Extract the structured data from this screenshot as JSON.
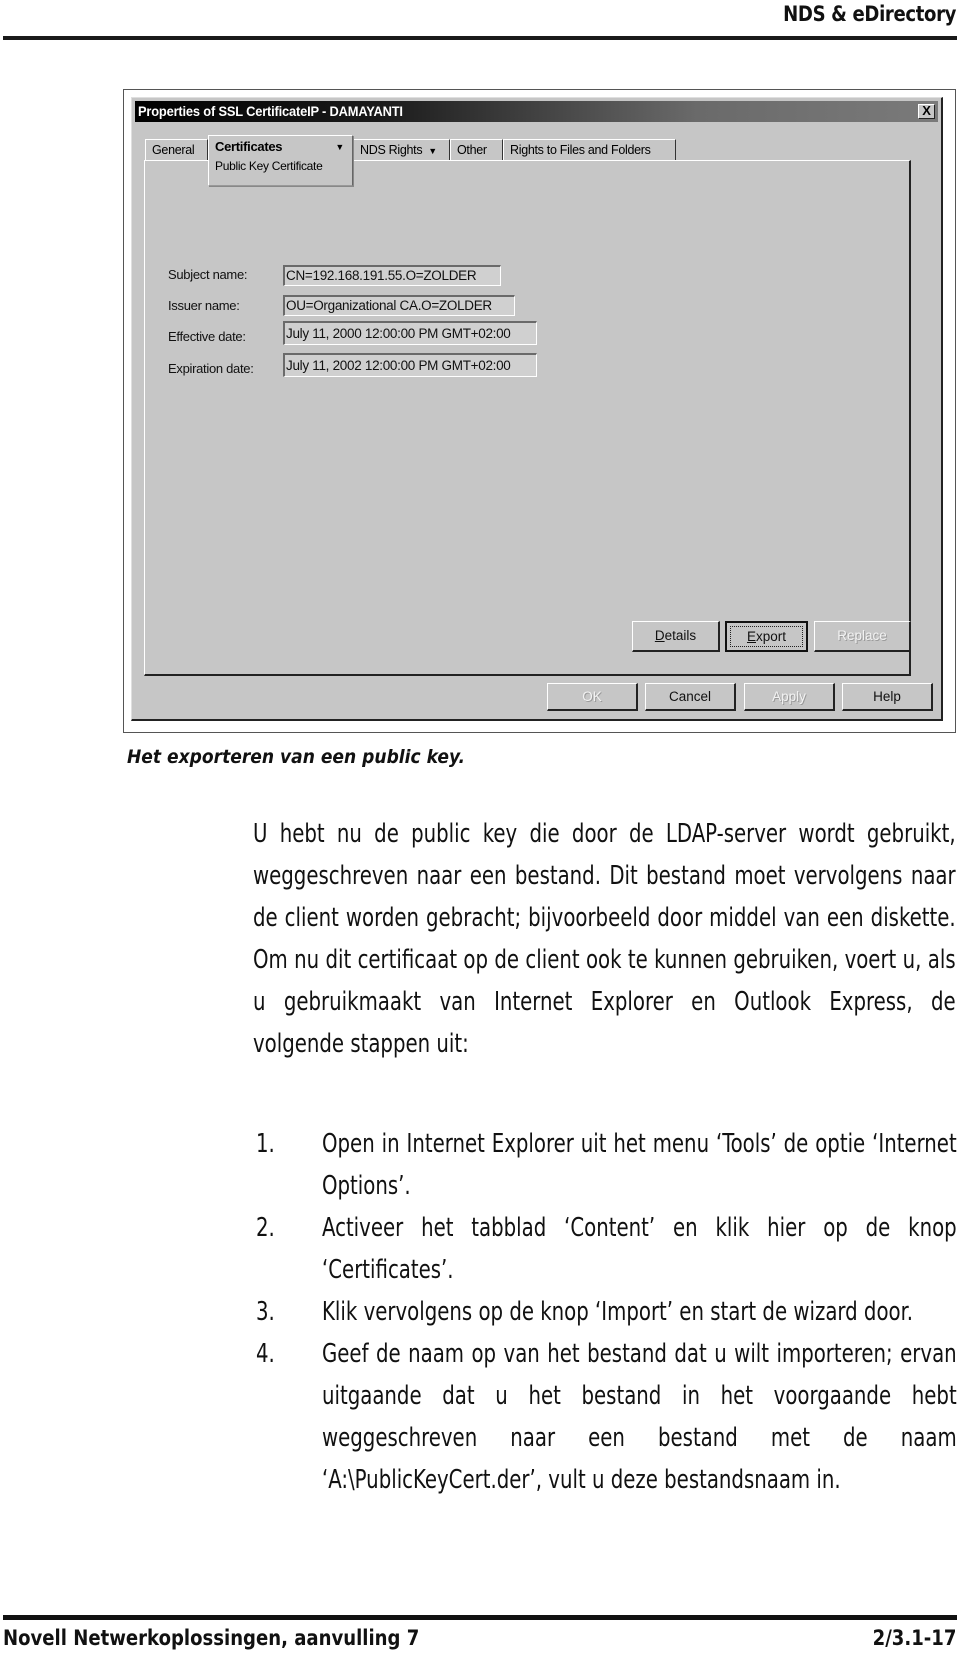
{
  "page": {
    "running_head": "NDS & eDirectory",
    "footer_left": "Novell Netwerkoplossingen, aanvulling 7",
    "footer_right": "2/3.1-17"
  },
  "dialog": {
    "title": "Properties of SSL CertificateIP - DAMAYANTI",
    "close_icon": "close-icon",
    "close_glyph": "X",
    "tabs": [
      {
        "label": "General",
        "active": false
      },
      {
        "label": "Certificates",
        "sublabel": "Public Key Certificate",
        "active": true,
        "has_dropdown": true
      },
      {
        "label": "NDS Rights",
        "active": false,
        "has_dropdown": true
      },
      {
        "label": "Other",
        "active": false
      },
      {
        "label": "Rights to Files and Folders",
        "active": false
      }
    ],
    "dropdown_glyph": "▼",
    "fields": [
      {
        "label": "Subject name:",
        "value": "CN=192.168.191.55.O=ZOLDER"
      },
      {
        "label": "Issuer name:",
        "value": "OU=Organizational CA.O=ZOLDER"
      },
      {
        "label": "Effective date:",
        "value": "July 11, 2000 12:00:00 PM GMT+02:00"
      },
      {
        "label": "Expiration date:",
        "value": "July 11, 2002 12:00:00 PM GMT+02:00"
      }
    ],
    "panel_buttons": {
      "details": {
        "label_hotkey": "D",
        "label_rest": "etails",
        "enabled": true
      },
      "export": {
        "label_hotkey": "E",
        "label_rest": "xport",
        "enabled": true,
        "default": true
      },
      "replace": {
        "label": "Replace",
        "enabled": false
      }
    },
    "footer_buttons": [
      {
        "label": "OK",
        "enabled": false
      },
      {
        "label": "Cancel",
        "enabled": true
      },
      {
        "label": "Apply",
        "enabled": false
      },
      {
        "label": "Help",
        "enabled": true
      }
    ]
  },
  "caption": "Het exporteren van een public key.",
  "body": {
    "intro": "U hebt nu de public key die door de LDAP-server wordt gebruikt, weggeschreven naar een bestand. Dit bestand moet vervolgens naar de client worden gebracht; bijvoorbeeld door middel van een diskette. Om nu dit certificaat op de client ook te kunnen gebruiken, voert u, als u gebruikmaakt van Internet Explorer en Outlook Express, de volgende stappen uit:",
    "steps": [
      {
        "num": "1.",
        "text": "Open in Internet Explorer uit het menu ‘Tools’ de optie ‘Internet Options’."
      },
      {
        "num": "2.",
        "text": "Activeer het tabblad ‘Content’ en klik hier op de knop ‘Certificates’."
      },
      {
        "num": "3.",
        "text": "Klik vervolgens op de knop ‘Import’ en start de wizard door."
      },
      {
        "num": "4.",
        "text": "Geef de naam op van het bestand dat u wilt importeren; ervan uitgaande dat u het bestand in het voorgaande hebt weggeschreven naar een bestand met de naam ‘A:\\PublicKeyCert.der’, vult u deze bestandsnaam in."
      }
    ]
  }
}
